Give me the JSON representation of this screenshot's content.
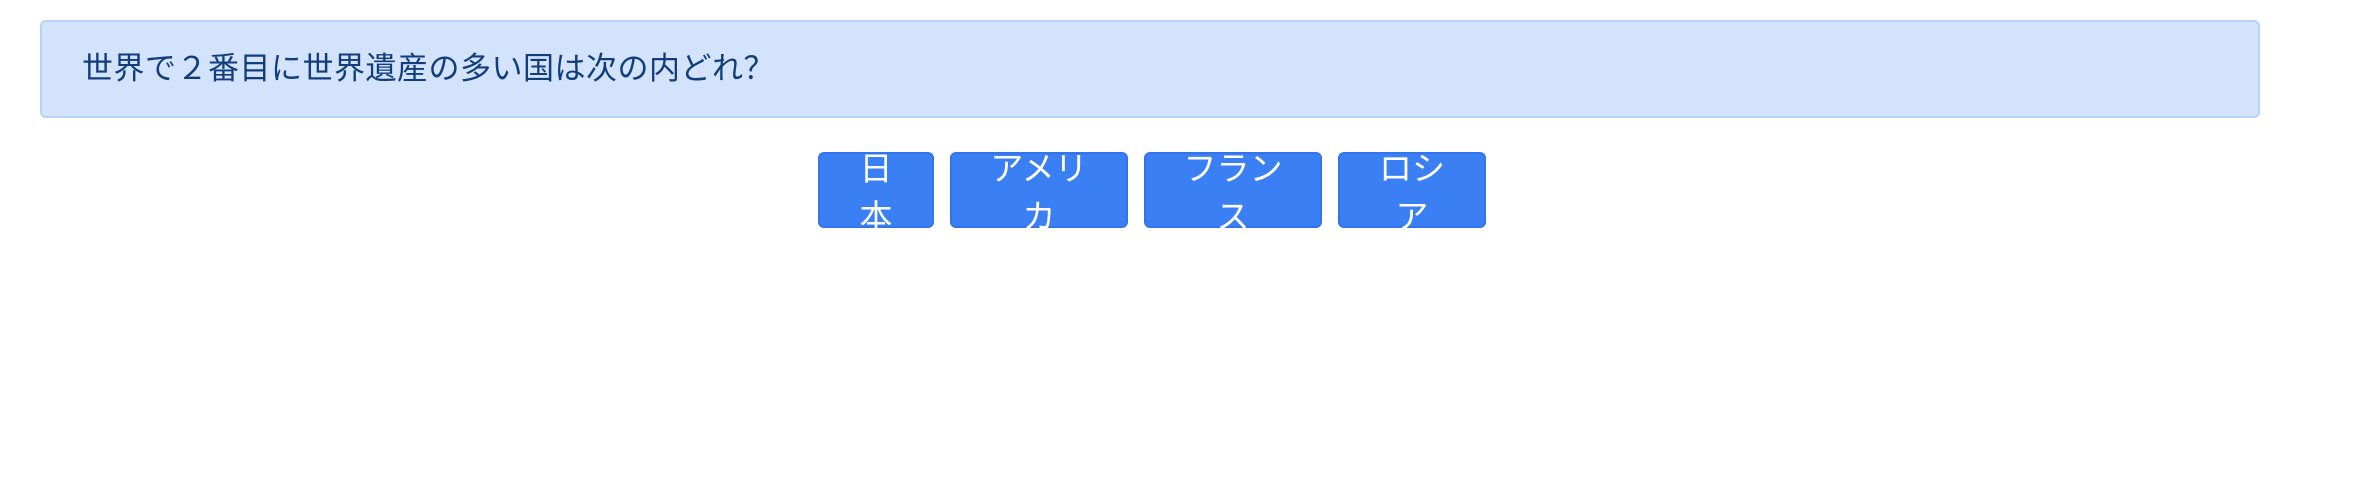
{
  "question": {
    "text": "世界で２番目に世界遺産の多い国は次の内どれ？"
  },
  "choices": [
    {
      "label": "日本"
    },
    {
      "label": "アメリカ"
    },
    {
      "label": "フランス"
    },
    {
      "label": "ロシア"
    }
  ],
  "colors": {
    "alert_background": "#d2e3fb",
    "alert_border": "#b7d1f8",
    "alert_text": "#123d7c",
    "button_background": "#3b7ff5",
    "button_text": "#ffffff"
  }
}
